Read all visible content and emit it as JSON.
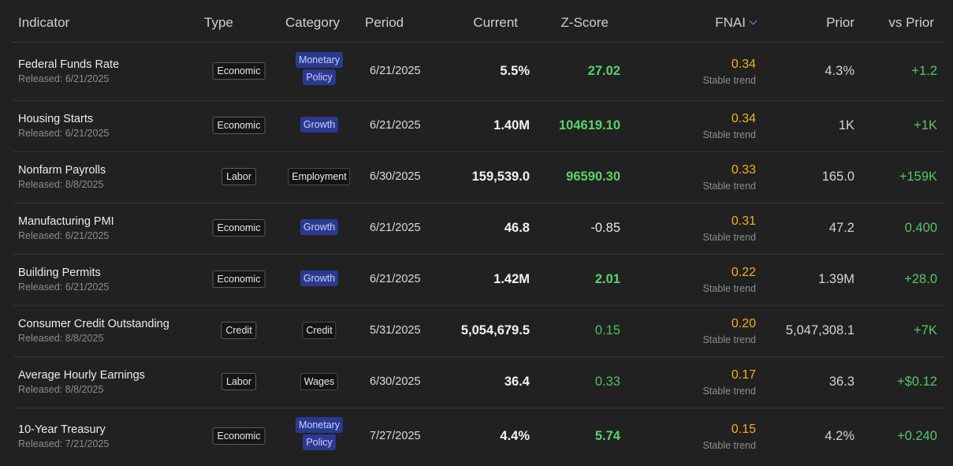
{
  "headers": {
    "indicator": "Indicator",
    "type": "Type",
    "category": "Category",
    "period": "Period",
    "current": "Current",
    "zscore": "Z-Score",
    "fnai": "FNAI",
    "prior": "Prior",
    "vs_prior": "vs Prior"
  },
  "sort": {
    "column": "FNAI",
    "direction": "descending",
    "icon": "chevron-down-icon",
    "icon_color": "#6b8cff"
  },
  "colors": {
    "background": "#212121",
    "positive": "#5bd16b",
    "negative": "#e25a4e",
    "fnai": "#f2b01e",
    "category_blue": "#2b3a8f"
  },
  "rows": [
    {
      "name": "Federal Funds Rate",
      "released": "Released: 6/21/2025",
      "type": "Economic",
      "category_lines": [
        "Monetary",
        "Policy"
      ],
      "category_style": "blue",
      "period": "6/21/2025",
      "current": "5.5%",
      "zscore": "27.02",
      "zscore_style": "strong",
      "fnai": "0.34",
      "fnai_note": "Stable trend",
      "prior": "4.3%",
      "vs_prior": "+1.2"
    },
    {
      "name": "Housing Starts",
      "released": "Released: 6/21/2025",
      "type": "Economic",
      "category_lines": [
        "Growth"
      ],
      "category_style": "blue",
      "period": "6/21/2025",
      "current": "1.40M",
      "zscore": "104619.10",
      "zscore_style": "strong",
      "fnai": "0.34",
      "fnai_note": "Stable trend",
      "prior": "1K",
      "vs_prior": "+1K"
    },
    {
      "name": "Nonfarm Payrolls",
      "released": "Released: 8/8/2025",
      "type": "Labor",
      "category_lines": [
        "Employment"
      ],
      "category_style": "dark",
      "period": "6/30/2025",
      "current": "159,539.0",
      "zscore": "96590.30",
      "zscore_style": "strong",
      "fnai": "0.33",
      "fnai_note": "Stable trend",
      "prior": "165.0",
      "vs_prior": "+159K"
    },
    {
      "name": "Manufacturing PMI",
      "released": "Released: 6/21/2025",
      "type": "Economic",
      "category_lines": [
        "Growth"
      ],
      "category_style": "blue",
      "period": "6/21/2025",
      "current": "46.8",
      "zscore": "-0.85",
      "zscore_style": "negative",
      "fnai": "0.31",
      "fnai_note": "Stable trend",
      "prior": "47.2",
      "vs_prior": "0.400"
    },
    {
      "name": "Building Permits",
      "released": "Released: 6/21/2025",
      "type": "Economic",
      "category_lines": [
        "Growth"
      ],
      "category_style": "blue",
      "period": "6/21/2025",
      "current": "1.42M",
      "zscore": "2.01",
      "zscore_style": "strong",
      "fnai": "0.22",
      "fnai_note": "Stable trend",
      "prior": "1.39M",
      "vs_prior": "+28.0"
    },
    {
      "name": "Consumer Credit Outstanding",
      "released": "Released: 8/8/2025",
      "type": "Credit",
      "category_lines": [
        "Credit"
      ],
      "category_style": "dark",
      "period": "5/31/2025",
      "current": "5,054,679.5",
      "zscore": "0.15",
      "zscore_style": "weak",
      "fnai": "0.20",
      "fnai_note": "Stable trend",
      "prior": "5,047,308.1",
      "vs_prior": "+7K"
    },
    {
      "name": "Average Hourly Earnings",
      "released": "Released: 8/8/2025",
      "type": "Labor",
      "category_lines": [
        "Wages"
      ],
      "category_style": "dark",
      "period": "6/30/2025",
      "current": "36.4",
      "zscore": "0.33",
      "zscore_style": "weak",
      "fnai": "0.17",
      "fnai_note": "Stable trend",
      "prior": "36.3",
      "vs_prior": "+$0.12"
    },
    {
      "name": "10-Year Treasury",
      "released": "Released: 7/21/2025",
      "type": "Economic",
      "category_lines": [
        "Monetary",
        "Policy"
      ],
      "category_style": "blue",
      "period": "7/27/2025",
      "current": "4.4%",
      "zscore": "5.74",
      "zscore_style": "strong",
      "fnai": "0.15",
      "fnai_note": "Stable trend",
      "prior": "4.2%",
      "vs_prior": "+0.240"
    }
  ]
}
